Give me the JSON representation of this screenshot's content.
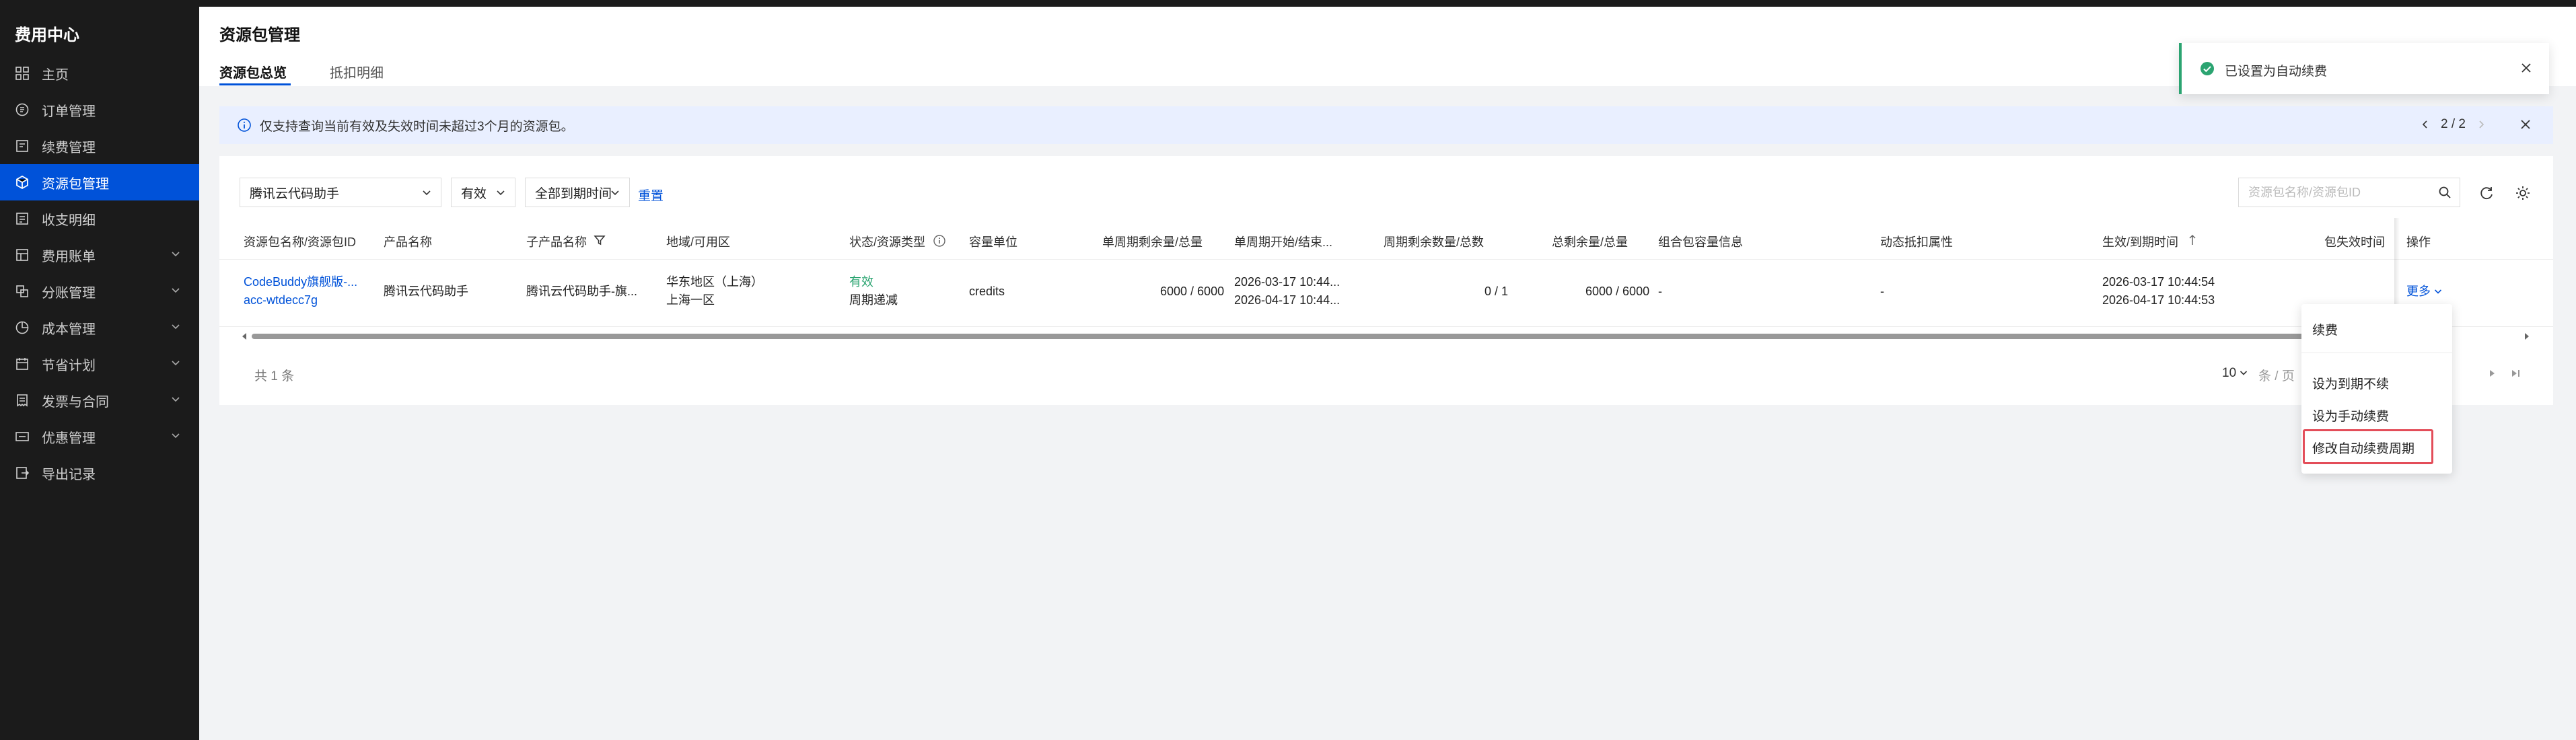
{
  "app": {
    "title": "费用中心"
  },
  "sidebar": {
    "items": [
      {
        "label": "主页",
        "icon": "grid-icon"
      },
      {
        "label": "订单管理",
        "icon": "order-icon"
      },
      {
        "label": "续费管理",
        "icon": "renew-icon"
      },
      {
        "label": "资源包管理",
        "icon": "package-icon",
        "active": true
      },
      {
        "label": "收支明细",
        "icon": "ledger-icon"
      },
      {
        "label": "费用账单",
        "icon": "bill-icon",
        "expandable": true
      },
      {
        "label": "分账管理",
        "icon": "split-icon",
        "expandable": true
      },
      {
        "label": "成本管理",
        "icon": "pie-icon",
        "expandable": true
      },
      {
        "label": "节省计划",
        "icon": "plan-icon",
        "expandable": true
      },
      {
        "label": "发票与合同",
        "icon": "invoice-icon",
        "expandable": true
      },
      {
        "label": "优惠管理",
        "icon": "coupon-icon",
        "expandable": true
      },
      {
        "label": "导出记录",
        "icon": "export-icon"
      }
    ]
  },
  "page": {
    "title": "资源包管理",
    "tabs": [
      {
        "label": "资源包总览",
        "active": true
      },
      {
        "label": "抵扣明细",
        "active": false
      }
    ]
  },
  "notice": {
    "text": "仅支持查询当前有效及失效时间未超过3个月的资源包。",
    "pager": "2 / 2"
  },
  "filters": {
    "product": "腾讯云代码助手",
    "status": "有效",
    "expiry": "全部到期时间",
    "reset": "重置",
    "search_placeholder": "资源包名称/资源包ID"
  },
  "table": {
    "columns": [
      "资源包名称/资源包ID",
      "产品名称",
      "子产品名称",
      "地域/可用区",
      "状态/资源类型",
      "容量单位",
      "单周期剩余量/总量",
      "单周期开始/结束...",
      "周期剩余数量/总数",
      "总剩余量/总量",
      "组合包容量信息",
      "动态抵扣属性",
      "生效/到期时间",
      "包失效时间",
      "操作"
    ],
    "rows": [
      {
        "name": "CodeBuddy旗舰版-...",
        "id": "acc-wtdecc7g",
        "product": "腾讯云代码助手",
        "subproduct": "腾讯云代码助手-旗...",
        "region": "华东地区（上海）",
        "zone": "上海一区",
        "status": "有效",
        "resource_type": "周期递减",
        "unit": "credits",
        "cycle_remaining": "6000 / 6000",
        "cycle_start": "2026-03-17 10:44...",
        "cycle_end": "2026-04-17 10:44...",
        "period_count": "0 / 1",
        "total_remaining": "6000 / 6000",
        "combo_info": "-",
        "dynamic_attr": "-",
        "effective": "2026-03-17 10:44:54",
        "expire": "2026-04-17 10:44:53",
        "action": "更多"
      }
    ],
    "total": "共 1 条",
    "page_size": "10",
    "page_size_unit": "条 / 页"
  },
  "dropdown": {
    "items": [
      "续费",
      "设为到期不续",
      "设为手动续费",
      "修改自动续费周期"
    ]
  },
  "toast": {
    "message": "已设置为自动续费"
  },
  "colors": {
    "accent": "#0052d9",
    "success": "#2ba471",
    "sidebar_bg": "#1b1b1b",
    "highlight": "#e34d59"
  }
}
